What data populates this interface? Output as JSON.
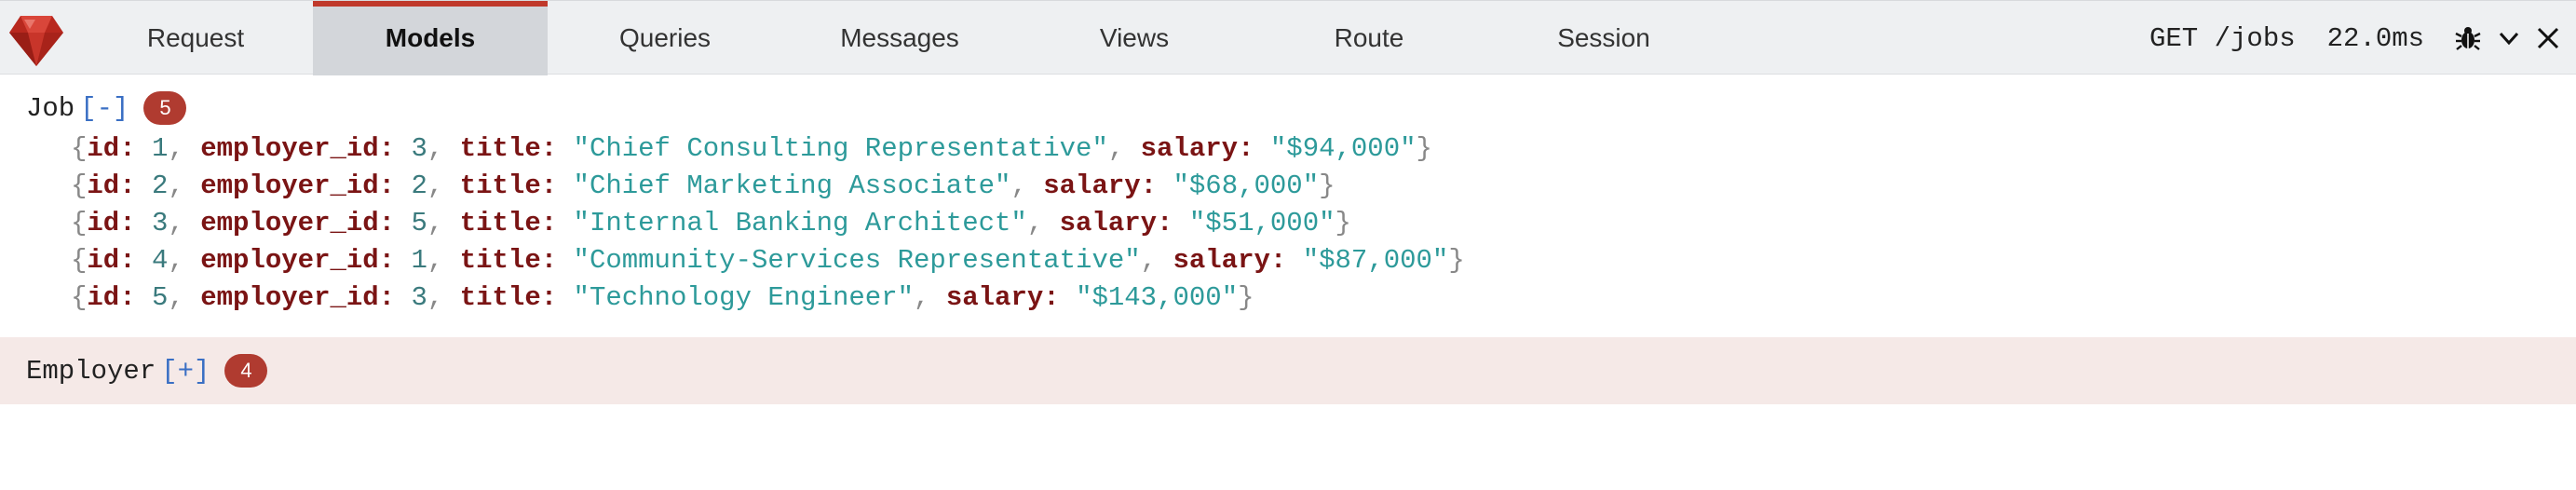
{
  "toolbar": {
    "logo_icon": "ruby-gem-icon",
    "tabs": [
      {
        "label": "Request"
      },
      {
        "label": "Models"
      },
      {
        "label": "Queries"
      },
      {
        "label": "Messages"
      },
      {
        "label": "Views"
      },
      {
        "label": "Route"
      },
      {
        "label": "Session"
      }
    ],
    "active_tab": "Models",
    "method_path": "GET /jobs",
    "duration": "22.0ms",
    "icons": [
      "bug-icon",
      "chevron-down-icon",
      "close-icon"
    ],
    "accent_color": "#c0392b"
  },
  "models": [
    {
      "name": "Job",
      "toggle": "[-]",
      "count": "5",
      "expanded": true,
      "records": [
        {
          "id": "1",
          "employer_id": "3",
          "title": "\"Chief Consulting Representative\"",
          "salary": "\"$94,000\""
        },
        {
          "id": "2",
          "employer_id": "2",
          "title": "\"Chief Marketing Associate\"",
          "salary": "\"$68,000\""
        },
        {
          "id": "3",
          "employer_id": "5",
          "title": "\"Internal Banking Architect\"",
          "salary": "\"$51,000\""
        },
        {
          "id": "4",
          "employer_id": "1",
          "title": "\"Community-Services Representative\"",
          "salary": "\"$87,000\""
        },
        {
          "id": "5",
          "employer_id": "3",
          "title": "\"Technology Engineer\"",
          "salary": "\"$143,000\""
        }
      ]
    },
    {
      "name": "Employer",
      "toggle": "[+]",
      "count": "4",
      "expanded": false
    }
  ],
  "keys": {
    "id": "id:",
    "employer_id": "employer_id:",
    "title": "title:",
    "salary": "salary:"
  },
  "punct": {
    "open": "{",
    "close": "}",
    "comma": ", "
  }
}
